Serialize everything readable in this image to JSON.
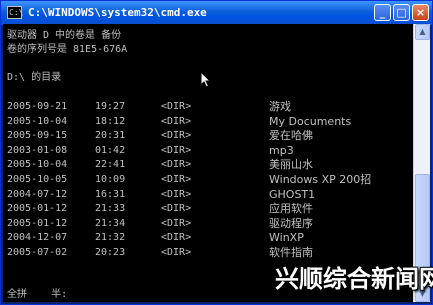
{
  "window": {
    "title": "C:\\WINDOWS\\system32\\cmd.exe",
    "icon_text": "C:\\",
    "minimize_label": "_",
    "maximize_label": "□",
    "close_label": "×"
  },
  "console": {
    "header_lines": [
      "驱动器 D 中的卷是 备份",
      "卷的序列号是 81E5-676A",
      "",
      "D:\\ 的目录"
    ],
    "entries": [
      {
        "date": "2005-09-21",
        "time": "19:27",
        "type": "<DIR>",
        "name": "游戏"
      },
      {
        "date": "2005-10-04",
        "time": "18:12",
        "type": "<DIR>",
        "name": "My Documents"
      },
      {
        "date": "2005-09-15",
        "time": "20:31",
        "type": "<DIR>",
        "name": "爱在哈佛"
      },
      {
        "date": "2003-01-08",
        "time": "01:42",
        "type": "<DIR>",
        "name": "mp3"
      },
      {
        "date": "2005-10-04",
        "time": "22:41",
        "type": "<DIR>",
        "name": "美丽山水"
      },
      {
        "date": "2005-10-05",
        "time": "10:09",
        "type": "<DIR>",
        "name": "Windows XP 200招"
      },
      {
        "date": "2004-07-12",
        "time": "16:31",
        "type": "<DIR>",
        "name": "GHOST1"
      },
      {
        "date": "2005-01-12",
        "time": "21:33",
        "type": "<DIR>",
        "name": "应用软件"
      },
      {
        "date": "2005-01-12",
        "time": "21:34",
        "type": "<DIR>",
        "name": "驱动程序"
      },
      {
        "date": "2004-12-07",
        "time": "21:32",
        "type": "<DIR>",
        "name": "WinXP"
      },
      {
        "date": "2005-07-02",
        "time": "20:23",
        "type": "<DIR>",
        "name": "软件指南"
      }
    ],
    "status_line": "全拼    半:"
  },
  "watermark": "兴顺综合新闻网",
  "colors": {
    "console_bg": "#000000",
    "console_fg": "#c0c0c0",
    "titlebar": "#0054e3"
  }
}
